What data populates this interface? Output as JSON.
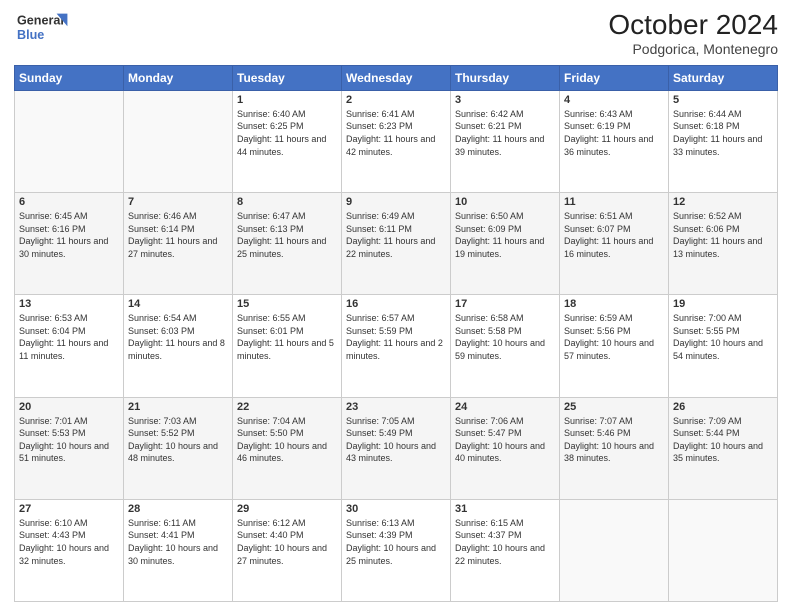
{
  "header": {
    "logo_line1": "General",
    "logo_line2": "Blue",
    "month": "October 2024",
    "location": "Podgorica, Montenegro"
  },
  "days_of_week": [
    "Sunday",
    "Monday",
    "Tuesday",
    "Wednesday",
    "Thursday",
    "Friday",
    "Saturday"
  ],
  "weeks": [
    [
      {
        "day": "",
        "info": ""
      },
      {
        "day": "",
        "info": ""
      },
      {
        "day": "1",
        "info": "Sunrise: 6:40 AM\nSunset: 6:25 PM\nDaylight: 11 hours and 44 minutes."
      },
      {
        "day": "2",
        "info": "Sunrise: 6:41 AM\nSunset: 6:23 PM\nDaylight: 11 hours and 42 minutes."
      },
      {
        "day": "3",
        "info": "Sunrise: 6:42 AM\nSunset: 6:21 PM\nDaylight: 11 hours and 39 minutes."
      },
      {
        "day": "4",
        "info": "Sunrise: 6:43 AM\nSunset: 6:19 PM\nDaylight: 11 hours and 36 minutes."
      },
      {
        "day": "5",
        "info": "Sunrise: 6:44 AM\nSunset: 6:18 PM\nDaylight: 11 hours and 33 minutes."
      }
    ],
    [
      {
        "day": "6",
        "info": "Sunrise: 6:45 AM\nSunset: 6:16 PM\nDaylight: 11 hours and 30 minutes."
      },
      {
        "day": "7",
        "info": "Sunrise: 6:46 AM\nSunset: 6:14 PM\nDaylight: 11 hours and 27 minutes."
      },
      {
        "day": "8",
        "info": "Sunrise: 6:47 AM\nSunset: 6:13 PM\nDaylight: 11 hours and 25 minutes."
      },
      {
        "day": "9",
        "info": "Sunrise: 6:49 AM\nSunset: 6:11 PM\nDaylight: 11 hours and 22 minutes."
      },
      {
        "day": "10",
        "info": "Sunrise: 6:50 AM\nSunset: 6:09 PM\nDaylight: 11 hours and 19 minutes."
      },
      {
        "day": "11",
        "info": "Sunrise: 6:51 AM\nSunset: 6:07 PM\nDaylight: 11 hours and 16 minutes."
      },
      {
        "day": "12",
        "info": "Sunrise: 6:52 AM\nSunset: 6:06 PM\nDaylight: 11 hours and 13 minutes."
      }
    ],
    [
      {
        "day": "13",
        "info": "Sunrise: 6:53 AM\nSunset: 6:04 PM\nDaylight: 11 hours and 11 minutes."
      },
      {
        "day": "14",
        "info": "Sunrise: 6:54 AM\nSunset: 6:03 PM\nDaylight: 11 hours and 8 minutes."
      },
      {
        "day": "15",
        "info": "Sunrise: 6:55 AM\nSunset: 6:01 PM\nDaylight: 11 hours and 5 minutes."
      },
      {
        "day": "16",
        "info": "Sunrise: 6:57 AM\nSunset: 5:59 PM\nDaylight: 11 hours and 2 minutes."
      },
      {
        "day": "17",
        "info": "Sunrise: 6:58 AM\nSunset: 5:58 PM\nDaylight: 10 hours and 59 minutes."
      },
      {
        "day": "18",
        "info": "Sunrise: 6:59 AM\nSunset: 5:56 PM\nDaylight: 10 hours and 57 minutes."
      },
      {
        "day": "19",
        "info": "Sunrise: 7:00 AM\nSunset: 5:55 PM\nDaylight: 10 hours and 54 minutes."
      }
    ],
    [
      {
        "day": "20",
        "info": "Sunrise: 7:01 AM\nSunset: 5:53 PM\nDaylight: 10 hours and 51 minutes."
      },
      {
        "day": "21",
        "info": "Sunrise: 7:03 AM\nSunset: 5:52 PM\nDaylight: 10 hours and 48 minutes."
      },
      {
        "day": "22",
        "info": "Sunrise: 7:04 AM\nSunset: 5:50 PM\nDaylight: 10 hours and 46 minutes."
      },
      {
        "day": "23",
        "info": "Sunrise: 7:05 AM\nSunset: 5:49 PM\nDaylight: 10 hours and 43 minutes."
      },
      {
        "day": "24",
        "info": "Sunrise: 7:06 AM\nSunset: 5:47 PM\nDaylight: 10 hours and 40 minutes."
      },
      {
        "day": "25",
        "info": "Sunrise: 7:07 AM\nSunset: 5:46 PM\nDaylight: 10 hours and 38 minutes."
      },
      {
        "day": "26",
        "info": "Sunrise: 7:09 AM\nSunset: 5:44 PM\nDaylight: 10 hours and 35 minutes."
      }
    ],
    [
      {
        "day": "27",
        "info": "Sunrise: 6:10 AM\nSunset: 4:43 PM\nDaylight: 10 hours and 32 minutes."
      },
      {
        "day": "28",
        "info": "Sunrise: 6:11 AM\nSunset: 4:41 PM\nDaylight: 10 hours and 30 minutes."
      },
      {
        "day": "29",
        "info": "Sunrise: 6:12 AM\nSunset: 4:40 PM\nDaylight: 10 hours and 27 minutes."
      },
      {
        "day": "30",
        "info": "Sunrise: 6:13 AM\nSunset: 4:39 PM\nDaylight: 10 hours and 25 minutes."
      },
      {
        "day": "31",
        "info": "Sunrise: 6:15 AM\nSunset: 4:37 PM\nDaylight: 10 hours and 22 minutes."
      },
      {
        "day": "",
        "info": ""
      },
      {
        "day": "",
        "info": ""
      }
    ]
  ]
}
